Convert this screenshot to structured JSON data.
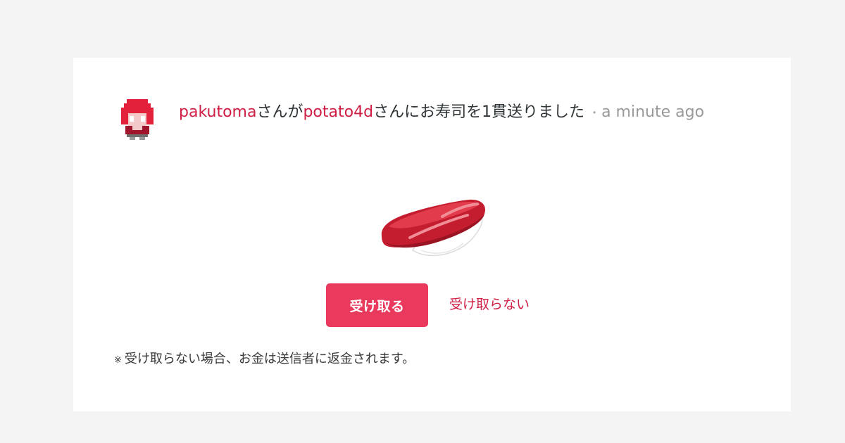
{
  "notification": {
    "sender": "pakutoma",
    "text_1": "さんが",
    "recipient": "potato4d",
    "text_2": "さんにお寿司を1貫送りました",
    "separator": "・",
    "time": "a minute ago"
  },
  "avatar_icon": "pixel-avatar-icon",
  "gift_icon": "tuna-sushi-icon",
  "actions": {
    "accept_label": "受け取る",
    "decline_label": "受け取らない"
  },
  "footnote": {
    "mark": "※",
    "text": "受け取らない場合、お金は送信者に返金されます。"
  },
  "colors": {
    "accent": "#e9395c",
    "link": "#cf1f45",
    "background": "#f4f4f4"
  }
}
